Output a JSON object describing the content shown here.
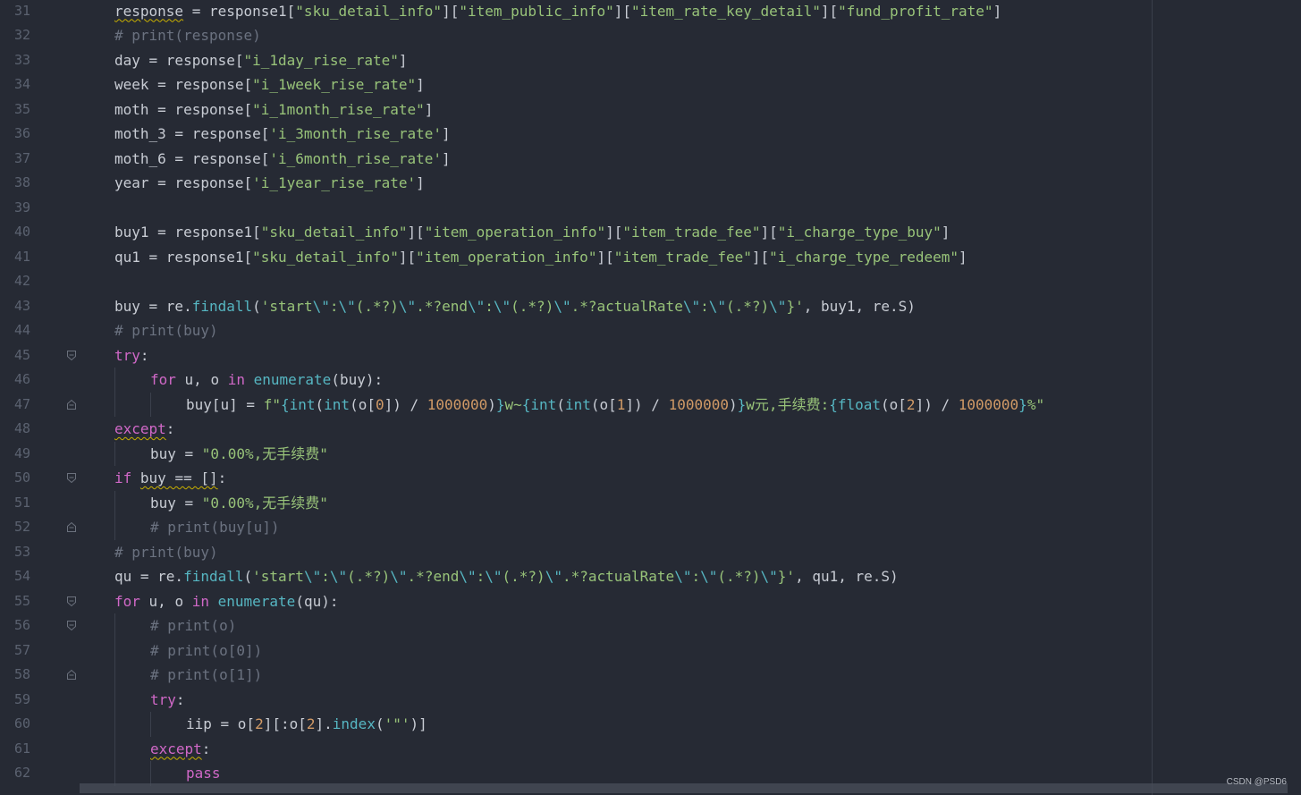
{
  "editor": {
    "lines": [
      {
        "num": "31",
        "indent": 0,
        "tokens": [
          {
            "t": "response",
            "c": "q w"
          },
          {
            "t": " = response1[",
            "c": "q"
          },
          {
            "t": "\"sku_detail_info\"",
            "c": "s"
          },
          {
            "t": "][",
            "c": "q"
          },
          {
            "t": "\"item_public_info\"",
            "c": "s"
          },
          {
            "t": "][",
            "c": "q"
          },
          {
            "t": "\"item_rate_key_detail\"",
            "c": "s"
          },
          {
            "t": "][",
            "c": "q"
          },
          {
            "t": "\"fund_profit_rate\"",
            "c": "s"
          },
          {
            "t": "]",
            "c": "q"
          }
        ]
      },
      {
        "num": "32",
        "indent": 0,
        "tokens": [
          {
            "t": "# print(response)",
            "c": "c"
          }
        ]
      },
      {
        "num": "33",
        "indent": 0,
        "tokens": [
          {
            "t": "day = response[",
            "c": "q"
          },
          {
            "t": "\"i_1day_rise_rate\"",
            "c": "s"
          },
          {
            "t": "]",
            "c": "q"
          }
        ]
      },
      {
        "num": "34",
        "indent": 0,
        "tokens": [
          {
            "t": "week = response[",
            "c": "q"
          },
          {
            "t": "\"i_1week_rise_rate\"",
            "c": "s"
          },
          {
            "t": "]",
            "c": "q"
          }
        ]
      },
      {
        "num": "35",
        "indent": 0,
        "tokens": [
          {
            "t": "moth = response[",
            "c": "q"
          },
          {
            "t": "\"i_1month_rise_rate\"",
            "c": "s"
          },
          {
            "t": "]",
            "c": "q"
          }
        ]
      },
      {
        "num": "36",
        "indent": 0,
        "tokens": [
          {
            "t": "moth_3 = response[",
            "c": "q"
          },
          {
            "t": "'i_3month_rise_rate'",
            "c": "s"
          },
          {
            "t": "]",
            "c": "q"
          }
        ]
      },
      {
        "num": "37",
        "indent": 0,
        "tokens": [
          {
            "t": "moth_6 = response[",
            "c": "q"
          },
          {
            "t": "'i_6month_rise_rate'",
            "c": "s"
          },
          {
            "t": "]",
            "c": "q"
          }
        ]
      },
      {
        "num": "38",
        "indent": 0,
        "tokens": [
          {
            "t": "year = response[",
            "c": "q"
          },
          {
            "t": "'i_1year_rise_rate'",
            "c": "s"
          },
          {
            "t": "]",
            "c": "q"
          }
        ]
      },
      {
        "num": "39",
        "indent": 0,
        "tokens": []
      },
      {
        "num": "40",
        "indent": 0,
        "tokens": [
          {
            "t": "buy1 = response1[",
            "c": "q"
          },
          {
            "t": "\"sku_detail_info\"",
            "c": "s"
          },
          {
            "t": "][",
            "c": "q"
          },
          {
            "t": "\"item_operation_info\"",
            "c": "s"
          },
          {
            "t": "][",
            "c": "q"
          },
          {
            "t": "\"item_trade_fee\"",
            "c": "s"
          },
          {
            "t": "][",
            "c": "q"
          },
          {
            "t": "\"i_charge_type_buy\"",
            "c": "s"
          },
          {
            "t": "]",
            "c": "q"
          }
        ]
      },
      {
        "num": "41",
        "indent": 0,
        "tokens": [
          {
            "t": "qu1 = response1[",
            "c": "q"
          },
          {
            "t": "\"sku_detail_info\"",
            "c": "s"
          },
          {
            "t": "][",
            "c": "q"
          },
          {
            "t": "\"item_operation_info\"",
            "c": "s"
          },
          {
            "t": "][",
            "c": "q"
          },
          {
            "t": "\"item_trade_fee\"",
            "c": "s"
          },
          {
            "t": "][",
            "c": "q"
          },
          {
            "t": "\"i_charge_type_redeem\"",
            "c": "s"
          },
          {
            "t": "]",
            "c": "q"
          }
        ]
      },
      {
        "num": "42",
        "indent": 0,
        "tokens": []
      },
      {
        "num": "43",
        "indent": 0,
        "tokens": [
          {
            "t": "buy = re.",
            "c": "q"
          },
          {
            "t": "findall",
            "c": "f"
          },
          {
            "t": "(",
            "c": "q"
          },
          {
            "t": "'start",
            "c": "s"
          },
          {
            "t": "\\\"",
            "c": "e"
          },
          {
            "t": ":",
            "c": "s"
          },
          {
            "t": "\\\"",
            "c": "e"
          },
          {
            "t": "(.*?)",
            "c": "s"
          },
          {
            "t": "\\\"",
            "c": "e"
          },
          {
            "t": ".*?end",
            "c": "s"
          },
          {
            "t": "\\\"",
            "c": "e"
          },
          {
            "t": ":",
            "c": "s"
          },
          {
            "t": "\\\"",
            "c": "e"
          },
          {
            "t": "(.*?)",
            "c": "s"
          },
          {
            "t": "\\\"",
            "c": "e"
          },
          {
            "t": ".*?actualRate",
            "c": "s"
          },
          {
            "t": "\\\"",
            "c": "e"
          },
          {
            "t": ":",
            "c": "s"
          },
          {
            "t": "\\\"",
            "c": "e"
          },
          {
            "t": "(.*?)",
            "c": "s"
          },
          {
            "t": "\\\"",
            "c": "e"
          },
          {
            "t": "}'",
            "c": "s"
          },
          {
            "t": ", buy1, re.S)",
            "c": "q"
          }
        ]
      },
      {
        "num": "44",
        "indent": 0,
        "tokens": [
          {
            "t": "# print(buy)",
            "c": "c"
          }
        ]
      },
      {
        "num": "45",
        "indent": 0,
        "fold": "open",
        "tokens": [
          {
            "t": "try",
            "c": "k"
          },
          {
            "t": ":",
            "c": "q"
          }
        ]
      },
      {
        "num": "46",
        "indent": 1,
        "tokens": [
          {
            "t": "for",
            "c": "k"
          },
          {
            "t": " u, o ",
            "c": "q"
          },
          {
            "t": "in",
            "c": "k"
          },
          {
            "t": " ",
            "c": "q"
          },
          {
            "t": "enumerate",
            "c": "f"
          },
          {
            "t": "(buy):",
            "c": "q"
          }
        ]
      },
      {
        "num": "47",
        "indent": 2,
        "fold": "close",
        "tokens": [
          {
            "t": "buy[u] = ",
            "c": "q"
          },
          {
            "t": "f\"",
            "c": "s"
          },
          {
            "t": "{",
            "c": "f"
          },
          {
            "t": "int",
            "c": "f"
          },
          {
            "t": "(",
            "c": "q"
          },
          {
            "t": "int",
            "c": "f"
          },
          {
            "t": "(o[",
            "c": "q"
          },
          {
            "t": "0",
            "c": "n"
          },
          {
            "t": "]) / ",
            "c": "q"
          },
          {
            "t": "1000000",
            "c": "n"
          },
          {
            "t": ")",
            "c": "q"
          },
          {
            "t": "}",
            "c": "f"
          },
          {
            "t": "w~",
            "c": "s"
          },
          {
            "t": "{",
            "c": "f"
          },
          {
            "t": "int",
            "c": "f"
          },
          {
            "t": "(",
            "c": "q"
          },
          {
            "t": "int",
            "c": "f"
          },
          {
            "t": "(o[",
            "c": "q"
          },
          {
            "t": "1",
            "c": "n"
          },
          {
            "t": "]) / ",
            "c": "q"
          },
          {
            "t": "1000000",
            "c": "n"
          },
          {
            "t": ")",
            "c": "q"
          },
          {
            "t": "}",
            "c": "f"
          },
          {
            "t": "w元,手续费:",
            "c": "s"
          },
          {
            "t": "{",
            "c": "f"
          },
          {
            "t": "float",
            "c": "f"
          },
          {
            "t": "(o[",
            "c": "q"
          },
          {
            "t": "2",
            "c": "n"
          },
          {
            "t": "]) / ",
            "c": "q"
          },
          {
            "t": "1000000",
            "c": "n"
          },
          {
            "t": "}",
            "c": "f"
          },
          {
            "t": "%\"",
            "c": "s"
          }
        ]
      },
      {
        "num": "48",
        "indent": 0,
        "tokens": [
          {
            "t": "except",
            "c": "k w"
          },
          {
            "t": ":",
            "c": "q"
          }
        ]
      },
      {
        "num": "49",
        "indent": 1,
        "tokens": [
          {
            "t": "buy = ",
            "c": "q"
          },
          {
            "t": "\"0.00%,无手续费\"",
            "c": "s"
          }
        ]
      },
      {
        "num": "50",
        "indent": 0,
        "fold": "open",
        "tokens": [
          {
            "t": "if",
            "c": "k"
          },
          {
            "t": " ",
            "c": "q"
          },
          {
            "t": "buy == []",
            "c": "q w"
          },
          {
            "t": ":",
            "c": "q"
          }
        ]
      },
      {
        "num": "51",
        "indent": 1,
        "tokens": [
          {
            "t": "buy = ",
            "c": "q"
          },
          {
            "t": "\"0.00%,无手续费\"",
            "c": "s"
          }
        ]
      },
      {
        "num": "52",
        "indent": 1,
        "fold": "close",
        "tokens": [
          {
            "t": "# print(buy[u])",
            "c": "c"
          }
        ]
      },
      {
        "num": "53",
        "indent": 0,
        "tokens": [
          {
            "t": "# print(buy)",
            "c": "c"
          }
        ]
      },
      {
        "num": "54",
        "indent": 0,
        "tokens": [
          {
            "t": "qu = re.",
            "c": "q"
          },
          {
            "t": "findall",
            "c": "f"
          },
          {
            "t": "(",
            "c": "q"
          },
          {
            "t": "'start",
            "c": "s"
          },
          {
            "t": "\\\"",
            "c": "e"
          },
          {
            "t": ":",
            "c": "s"
          },
          {
            "t": "\\\"",
            "c": "e"
          },
          {
            "t": "(.*?)",
            "c": "s"
          },
          {
            "t": "\\\"",
            "c": "e"
          },
          {
            "t": ".*?end",
            "c": "s"
          },
          {
            "t": "\\\"",
            "c": "e"
          },
          {
            "t": ":",
            "c": "s"
          },
          {
            "t": "\\\"",
            "c": "e"
          },
          {
            "t": "(.*?)",
            "c": "s"
          },
          {
            "t": "\\\"",
            "c": "e"
          },
          {
            "t": ".*?actualRate",
            "c": "s"
          },
          {
            "t": "\\\"",
            "c": "e"
          },
          {
            "t": ":",
            "c": "s"
          },
          {
            "t": "\\\"",
            "c": "e"
          },
          {
            "t": "(.*?)",
            "c": "s"
          },
          {
            "t": "\\\"",
            "c": "e"
          },
          {
            "t": "}'",
            "c": "s"
          },
          {
            "t": ", qu1, re.S)",
            "c": "q"
          }
        ]
      },
      {
        "num": "55",
        "indent": 0,
        "fold": "open",
        "tokens": [
          {
            "t": "for",
            "c": "k"
          },
          {
            "t": " u, o ",
            "c": "q"
          },
          {
            "t": "in",
            "c": "k"
          },
          {
            "t": " ",
            "c": "q"
          },
          {
            "t": "enumerate",
            "c": "f"
          },
          {
            "t": "(qu):",
            "c": "q"
          }
        ]
      },
      {
        "num": "56",
        "indent": 1,
        "fold": "open",
        "tokens": [
          {
            "t": "# print(o)",
            "c": "c"
          }
        ]
      },
      {
        "num": "57",
        "indent": 1,
        "tokens": [
          {
            "t": "# print(o[0])",
            "c": "c"
          }
        ]
      },
      {
        "num": "58",
        "indent": 1,
        "fold": "close",
        "tokens": [
          {
            "t": "# print(o[1])",
            "c": "c"
          }
        ]
      },
      {
        "num": "59",
        "indent": 1,
        "tokens": [
          {
            "t": "try",
            "c": "k"
          },
          {
            "t": ":",
            "c": "q"
          }
        ]
      },
      {
        "num": "60",
        "indent": 2,
        "tokens": [
          {
            "t": "iip = o[",
            "c": "q"
          },
          {
            "t": "2",
            "c": "n"
          },
          {
            "t": "][:o[",
            "c": "q"
          },
          {
            "t": "2",
            "c": "n"
          },
          {
            "t": "].",
            "c": "q"
          },
          {
            "t": "index",
            "c": "f"
          },
          {
            "t": "(",
            "c": "q"
          },
          {
            "t": "'\"'",
            "c": "s"
          },
          {
            "t": ")]",
            "c": "q"
          }
        ]
      },
      {
        "num": "61",
        "indent": 1,
        "tokens": [
          {
            "t": "except",
            "c": "k w"
          },
          {
            "t": ":",
            "c": "q"
          }
        ]
      },
      {
        "num": "62",
        "indent": 2,
        "tokens": [
          {
            "t": "pass",
            "c": "k"
          }
        ]
      }
    ]
  },
  "watermark": "CSDN @PSD6"
}
